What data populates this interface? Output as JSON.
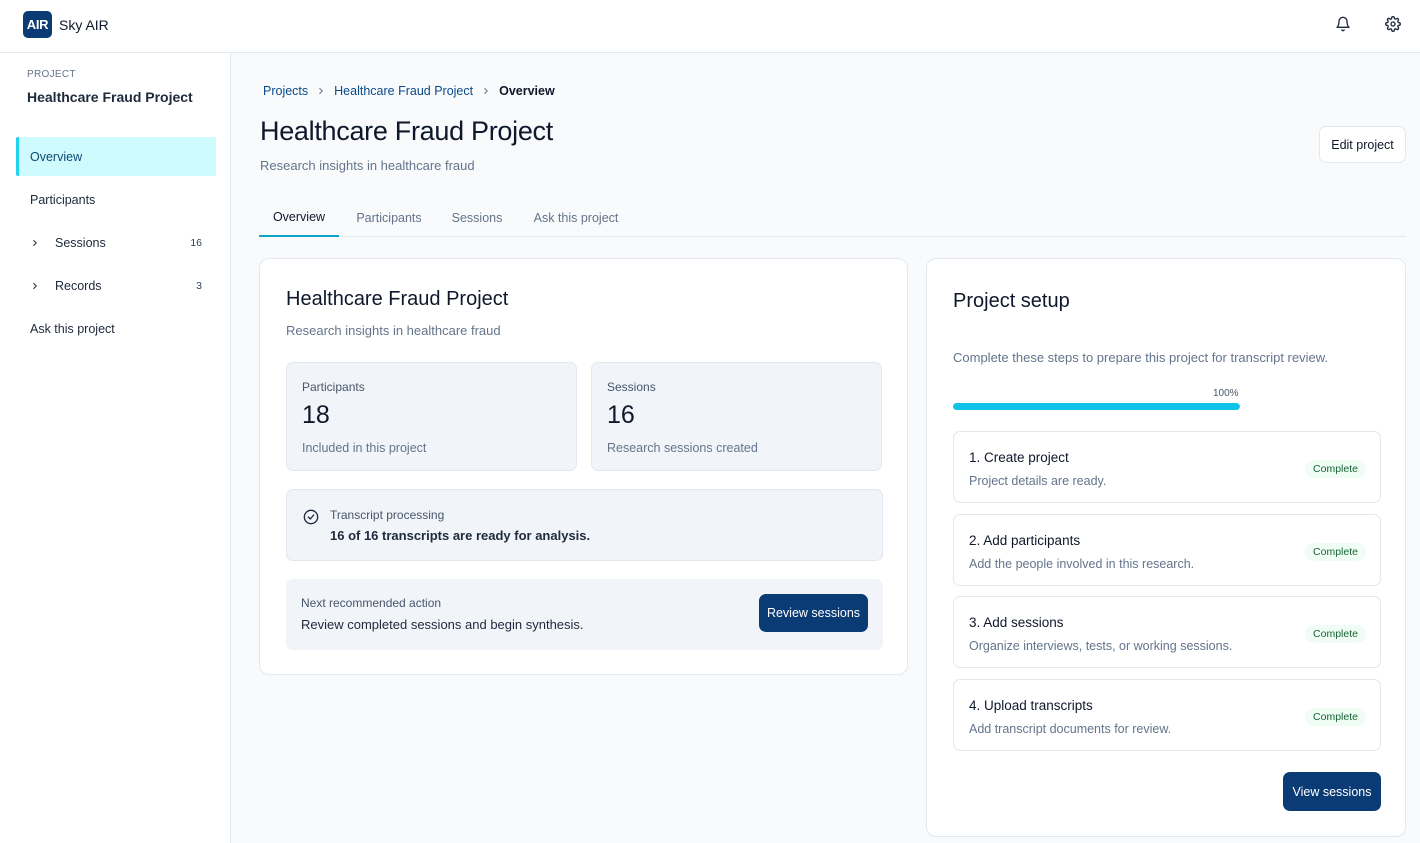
{
  "app": {
    "logo_text": "AIR",
    "name": "Sky AIR"
  },
  "topbar": {
    "icons": [
      "bell-icon",
      "gear-icon"
    ]
  },
  "sidebar": {
    "kicker": "PROJECT",
    "project_name": "Healthcare Fraud Project",
    "items": [
      {
        "label": "Overview",
        "active": true
      },
      {
        "label": "Participants"
      },
      {
        "label": "Sessions",
        "count": "16",
        "expandable": true
      },
      {
        "label": "Records",
        "count": "3",
        "expandable": true
      },
      {
        "label": "Ask this project"
      }
    ]
  },
  "breadcrumb": {
    "items": [
      "Projects",
      "Healthcare Fraud Project"
    ],
    "current": "Overview"
  },
  "header": {
    "title": "Healthcare Fraud Project",
    "subtitle": "Research insights in healthcare fraud",
    "edit_label": "Edit project"
  },
  "tabs": [
    "Overview",
    "Participants",
    "Sessions",
    "Ask this project"
  ],
  "overview": {
    "title": "Healthcare Fraud Project",
    "subtitle": "Research insights in healthcare fraud",
    "stats": [
      {
        "label": "Participants",
        "value": "18",
        "desc": "Included in this project"
      },
      {
        "label": "Sessions",
        "value": "16",
        "desc": "Research sessions created"
      }
    ],
    "processing": {
      "label": "Transcript processing",
      "text": "16 of 16 transcripts are ready for analysis."
    },
    "next": {
      "label": "Next recommended action",
      "text": "Review completed sessions and begin synthesis.",
      "button": "Review sessions"
    }
  },
  "setup": {
    "title": "Project setup",
    "subtitle": "Complete these steps to prepare this project for transcript review.",
    "progress_label": "100%",
    "progress": 1.0,
    "steps": [
      {
        "title": "1. Create project",
        "desc": "Project details are ready.",
        "status": "Complete"
      },
      {
        "title": "2. Add participants",
        "desc": "Add the people involved in this research.",
        "status": "Complete"
      },
      {
        "title": "3. Add sessions",
        "desc": "Organize interviews, tests, or working sessions.",
        "status": "Complete"
      },
      {
        "title": "4. Upload transcripts",
        "desc": "Add transcript documents for review.",
        "status": "Complete"
      }
    ],
    "button": "View sessions"
  },
  "colors": {
    "brand": "#0b3b75",
    "accent": "#0ec2e8",
    "active_bg": "#cffafe",
    "success": "#166534"
  }
}
